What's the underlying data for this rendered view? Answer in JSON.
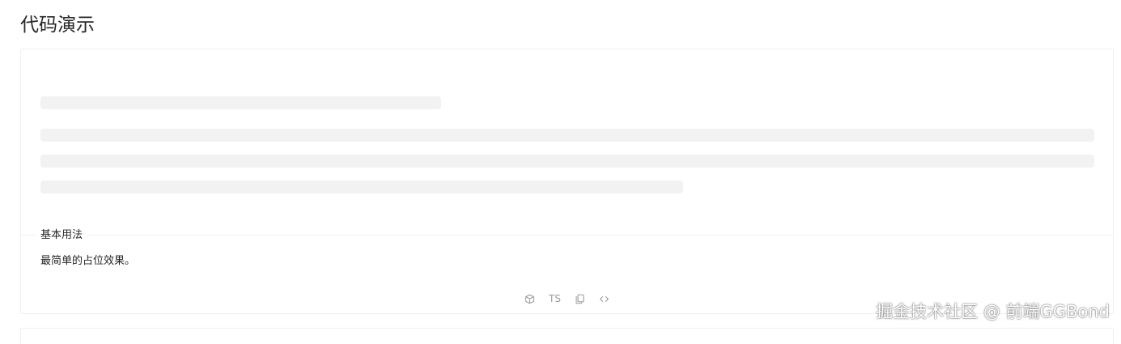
{
  "page": {
    "title": "代码演示"
  },
  "demo": {
    "title": "基本用法",
    "description": "最简单的占位效果。",
    "actions": {
      "codesandbox_icon": "cube-icon",
      "ts_label": "TS",
      "copy_icon": "copy-icon",
      "code_icon": "code-icon"
    }
  },
  "watermark": "掘金技术社区 @ 前端GGBond"
}
